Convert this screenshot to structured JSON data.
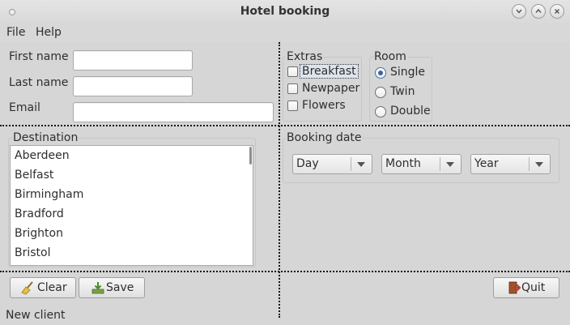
{
  "window": {
    "title": "Hotel booking"
  },
  "menu": {
    "items": [
      "File",
      "Help"
    ]
  },
  "client_form": {
    "first_name_label": "First name",
    "first_name_value": "",
    "last_name_label": "Last name",
    "last_name_value": "",
    "email_label": "Email",
    "email_value": ""
  },
  "extras": {
    "label": "Extras",
    "options": [
      {
        "label": "Breakfast",
        "checked": false
      },
      {
        "label": "Newpaper",
        "checked": false
      },
      {
        "label": "Flowers",
        "checked": false
      }
    ]
  },
  "room": {
    "label": "Room",
    "options": [
      {
        "label": "Single",
        "selected": true
      },
      {
        "label": "Twin",
        "selected": false
      },
      {
        "label": "Double",
        "selected": false
      }
    ]
  },
  "destination": {
    "label": "Destination",
    "items": [
      "Aberdeen",
      "Belfast",
      "Birmingham",
      "Bradford",
      "Brighton",
      "Bristol"
    ]
  },
  "booking_date": {
    "label": "Booking date",
    "day": "Day",
    "month": "Month",
    "year": "Year"
  },
  "buttons": {
    "clear": "Clear",
    "save": "Save",
    "quit": "Quit"
  },
  "status": {
    "text": "New client"
  },
  "colors": {
    "background": "#d6d6d6",
    "radio_accent": "#3a65a8",
    "quit_icon_accent": "#c0392b"
  },
  "icons": [
    "broom-icon",
    "save-icon",
    "exit-door-icon"
  ]
}
